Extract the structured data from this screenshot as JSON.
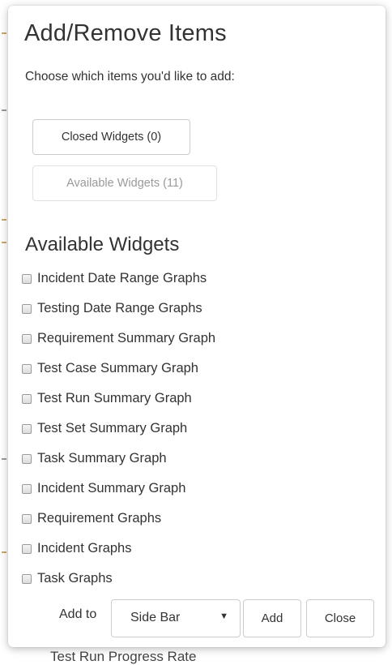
{
  "dialog": {
    "title": "Add/Remove Items",
    "subtitle": "Choose which items you'd like to add:",
    "tabs": [
      {
        "label": "Closed Widgets (0)",
        "enabled": true
      },
      {
        "label": "Available Widgets (11)",
        "enabled": false
      }
    ],
    "section_heading": "Available Widgets",
    "widgets": [
      {
        "label": "Incident Date Range Graphs",
        "checked": false
      },
      {
        "label": "Testing Date Range Graphs",
        "checked": false
      },
      {
        "label": "Requirement Summary Graph",
        "checked": false
      },
      {
        "label": "Test Case Summary Graph",
        "checked": false
      },
      {
        "label": "Test Run Summary Graph",
        "checked": false
      },
      {
        "label": "Test Set Summary Graph",
        "checked": false
      },
      {
        "label": "Task Summary Graph",
        "checked": false
      },
      {
        "label": "Incident Summary Graph",
        "checked": false
      },
      {
        "label": "Requirement Graphs",
        "checked": false
      },
      {
        "label": "Incident Graphs",
        "checked": false
      },
      {
        "label": "Task Graphs",
        "checked": false
      }
    ],
    "footer": {
      "add_to_label": "Add to",
      "select_value": "Side Bar",
      "select_caret": "▼",
      "add_label": "Add",
      "close_label": "Close"
    }
  },
  "background": {
    "partial_text": "Test Run Progress Rate"
  }
}
